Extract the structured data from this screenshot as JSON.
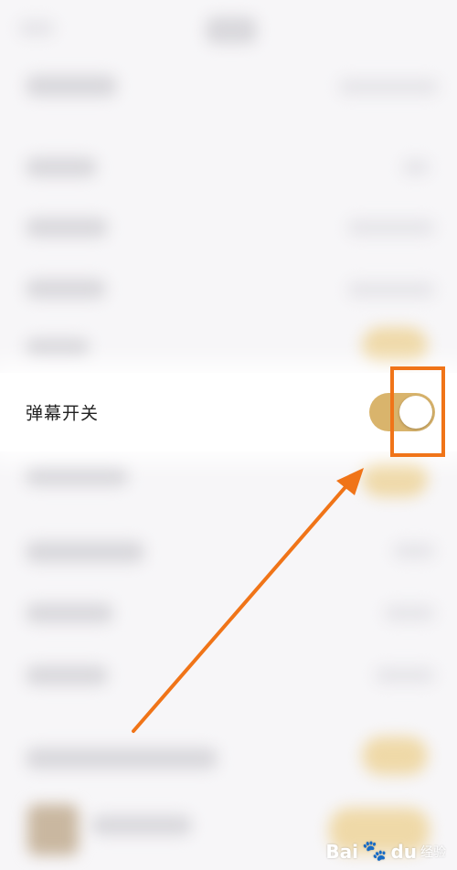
{
  "setting": {
    "label": "弹幕开关",
    "enabled": true
  },
  "annotation": {
    "arrow_color": "#f07418",
    "box_color": "#f07418"
  },
  "watermark": {
    "brand": "Bai",
    "paw": "🐾",
    "brand2": "du",
    "sub": "经验"
  },
  "colors": {
    "toggle_on": "#d9b46c",
    "background": "#f7f6f8"
  }
}
